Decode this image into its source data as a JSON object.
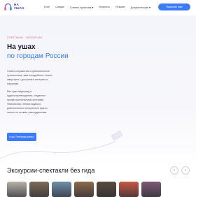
{
  "header": {
    "logo_line1": "НА",
    "logo_line2": "УШАХ",
    "nav": [
      "Блог",
      "Скидки",
      "Советы туристам ▾",
      "Вопросы",
      "Отзывы",
      "Документация ▾"
    ],
    "cta_label": "Написать нам"
  },
  "hero": {
    "tagline": "СПЕКТАКЛИ · ЭКСКУРСИИ",
    "title_line1": "На ушах",
    "title_line2": "по городам России",
    "paragraph1": "Чтобы отправиться в увлекательное путешествие, вам понадобится только смартфон с доступом в интернет и наушники.",
    "paragraph2": "Вас ждет видеоряд в аудиосопровождении, созданное профессиональными актерами. Уникальная, легкая подача и действительно интересные факты никого не оставят равнодушными.",
    "button_label": "Наш Телеграм-канал"
  },
  "section": {
    "title": "Экскурсии-спектакли без гида",
    "prev_icon": "chevron-left-icon",
    "next_icon": "chevron-right-icon"
  },
  "cards": [
    {
      "name": "tour-card-1",
      "color": "#b7b1a8"
    },
    {
      "name": "tour-card-2",
      "color": "#7c6a56"
    },
    {
      "name": "tour-card-3",
      "color": "#6e8fa9"
    },
    {
      "name": "tour-card-4",
      "color": "#8b6a4a"
    },
    {
      "name": "tour-card-5",
      "color": "#5b4b3c"
    },
    {
      "name": "tour-card-6",
      "color": "#c55a44"
    },
    {
      "name": "tour-card-7",
      "color": "#7d5a73"
    }
  ],
  "colors": {
    "accent": "#3a7bff",
    "brand": "#4a3ea5",
    "tagline": "#e0607a"
  }
}
